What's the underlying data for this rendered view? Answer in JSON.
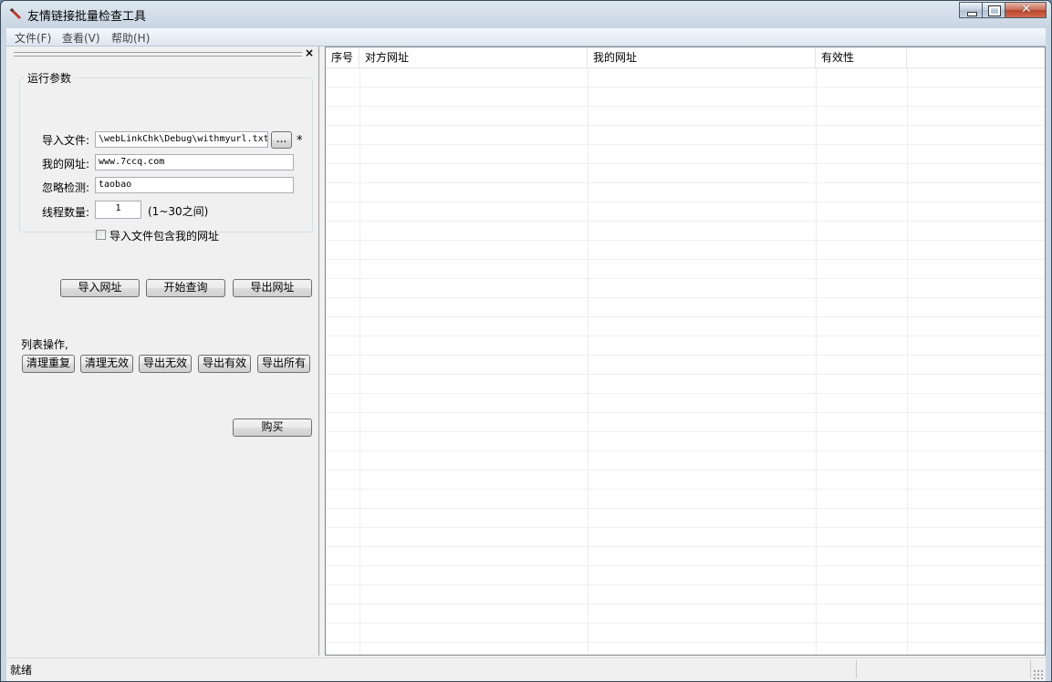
{
  "window": {
    "title": "友情链接批量检查工具"
  },
  "menu": {
    "items": [
      "文件(F)",
      "查看(V)",
      "帮助(H)"
    ]
  },
  "panel": {
    "close_glyph": "×",
    "group_title": "运行参数",
    "import_file_label": "导入文件:",
    "import_file_value": "\\webLinkChk\\Debug\\withmyurl.txt",
    "browse_label": "...",
    "required_mark": "*",
    "my_url_label": "我的网址:",
    "my_url_value": "www.7ccq.com",
    "ignore_label": "忽略检测:",
    "ignore_value": "taobao",
    "threads_label": "线程数量:",
    "threads_value": "1",
    "threads_hint": "(1~30之间)",
    "include_my_url_label": "导入文件包含我的网址",
    "import_button": "导入网址",
    "start_button": "开始查询",
    "export_button": "导出网址",
    "list_ops_label": "列表操作,",
    "list_ops": [
      "清理重复",
      "清理无效",
      "导出无效",
      "导出有效",
      "导出所有"
    ],
    "buy_button": "购买"
  },
  "table": {
    "columns": [
      "序号",
      "对方网址",
      "我的网址",
      "有效性",
      ""
    ]
  },
  "status": {
    "text": "就绪"
  },
  "colors": {
    "title_bar": "#c9d6e3",
    "panel_bg": "#f0f0f0",
    "close_button": "#c86a55"
  }
}
